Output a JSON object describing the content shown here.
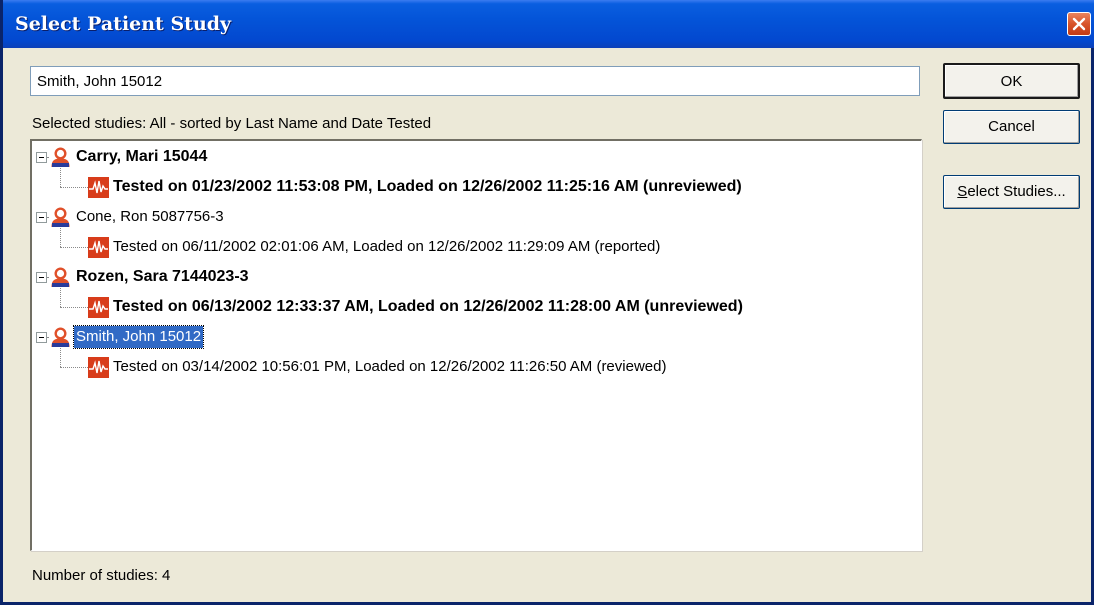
{
  "window": {
    "title": "Select Patient Study",
    "close_icon": "close-icon"
  },
  "search": {
    "value": "Smith, John 15012"
  },
  "selection_label": "Selected studies:  All - sorted by Last Name and Date Tested",
  "buttons": {
    "ok": "OK",
    "cancel": "Cancel",
    "select_studies_accel": "S",
    "select_studies_rest": "elect Studies..."
  },
  "tree": {
    "patients": [
      {
        "name": "Carry, Mari 15044",
        "bold": true,
        "selected": false,
        "icon": "patient-icon",
        "study": {
          "text": "Tested on 01/23/2002 11:53:08 PM, Loaded on 12/26/2002 11:25:16 AM (unreviewed)",
          "bold": true,
          "icon": "waveform-icon"
        }
      },
      {
        "name": "Cone, Ron 5087756-3",
        "bold": false,
        "selected": false,
        "icon": "patient-icon",
        "study": {
          "text": "Tested on 06/11/2002 02:01:06 AM, Loaded on 12/26/2002 11:29:09 AM (reported)",
          "bold": false,
          "icon": "waveform-icon"
        }
      },
      {
        "name": "Rozen, Sara 7144023-3",
        "bold": true,
        "selected": false,
        "icon": "patient-icon",
        "study": {
          "text": "Tested on 06/13/2002 12:33:37 AM, Loaded on 12/26/2002 11:28:00 AM (unreviewed)",
          "bold": true,
          "icon": "waveform-icon"
        }
      },
      {
        "name": "Smith, John 15012",
        "bold": false,
        "selected": true,
        "icon": "patient-icon",
        "study": {
          "text": "Tested on 03/14/2002 10:56:01 PM, Loaded on 12/26/2002 11:26:50 AM (reviewed)",
          "bold": false,
          "icon": "waveform-icon"
        }
      }
    ]
  },
  "footer": {
    "count_label": "Number of studies: 4"
  },
  "colors": {
    "titlebar": "#0454d8",
    "selection": "#316ac5",
    "patient_icon": "#e0502a",
    "waveform_icon": "#d83c1a"
  }
}
